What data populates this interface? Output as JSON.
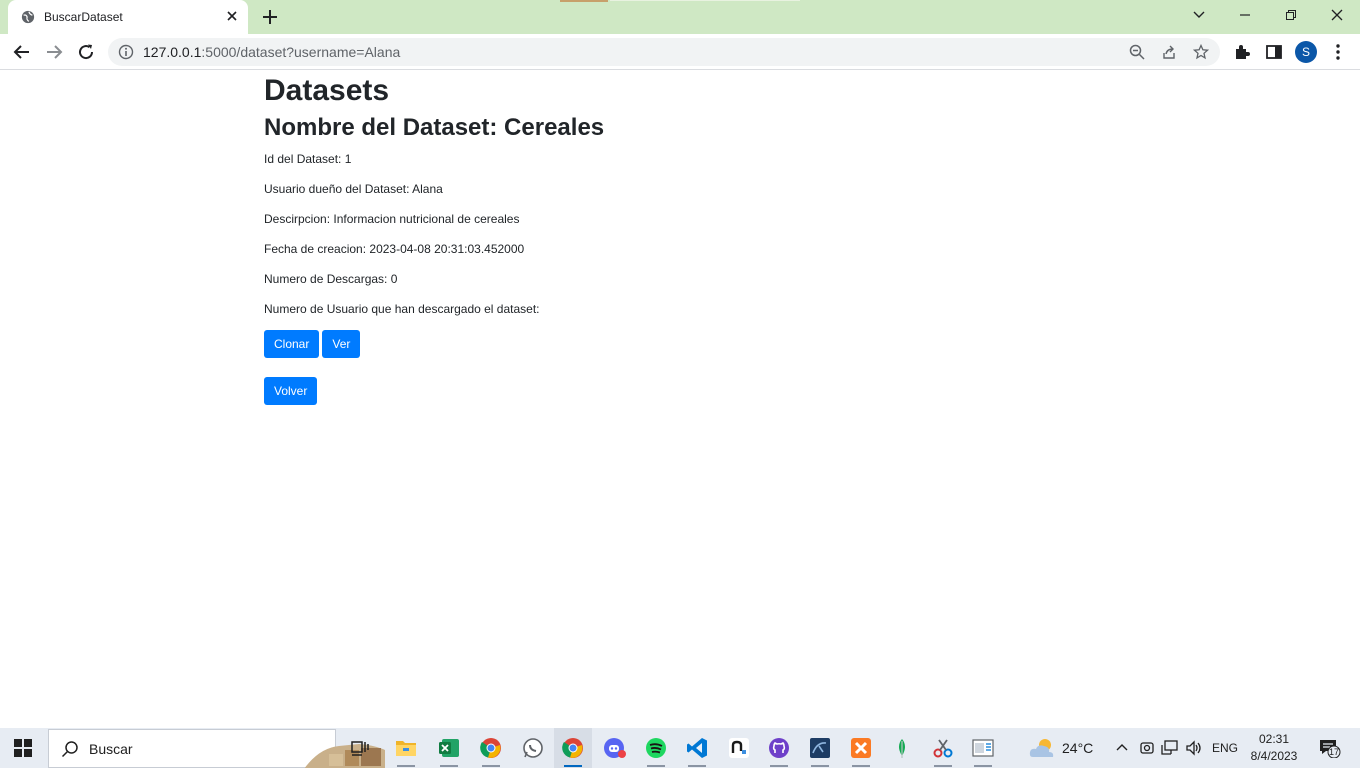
{
  "browser": {
    "tab_title": "BuscarDataset",
    "url_host": "127.0.0.1",
    "url_rest": ":5000/dataset?username=Alana",
    "profile_initial": "S"
  },
  "page": {
    "heading": "Datasets",
    "dataset_name_line": "Nombre del Dataset: Cereales",
    "id_line": "Id del Dataset: 1",
    "owner_line": "Usuario dueño del Dataset: Alana",
    "description_line": "Descirpcion: Informacion nutricional de cereales",
    "created_line": "Fecha de creacion: 2023-04-08 20:31:03.452000",
    "downloads_line": "Numero de Descargas: 0",
    "downloaders_line": "Numero de Usuario que han descargado el dataset:",
    "clone_button": "Clonar",
    "view_button": "Ver",
    "back_button": "Volver"
  },
  "taskbar": {
    "search_placeholder": "Buscar",
    "temperature": "24°C",
    "language": "ENG",
    "time": "02:31",
    "date": "8/4/2023",
    "notifications": "17"
  },
  "colors": {
    "primary_button": "#007bff",
    "tab_strip": "#cfe8c4",
    "profile": "#0b57a8"
  }
}
